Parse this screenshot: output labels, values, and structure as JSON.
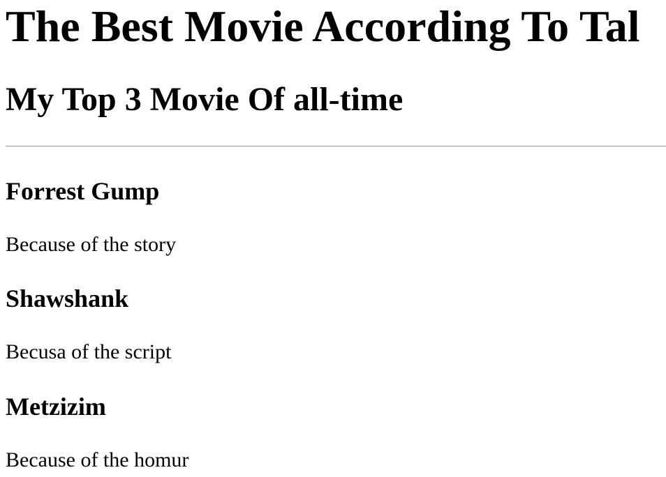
{
  "header": {
    "title": "The Best Movie According To Tal",
    "subtitle": "My Top 3 Movie Of all-time"
  },
  "movies": [
    {
      "name": "Forrest Gump",
      "reason": "Because of the story"
    },
    {
      "name": "Shawshank",
      "reason": "Becusa of the script"
    },
    {
      "name": "Metzizim",
      "reason": "Because of the homur"
    }
  ]
}
